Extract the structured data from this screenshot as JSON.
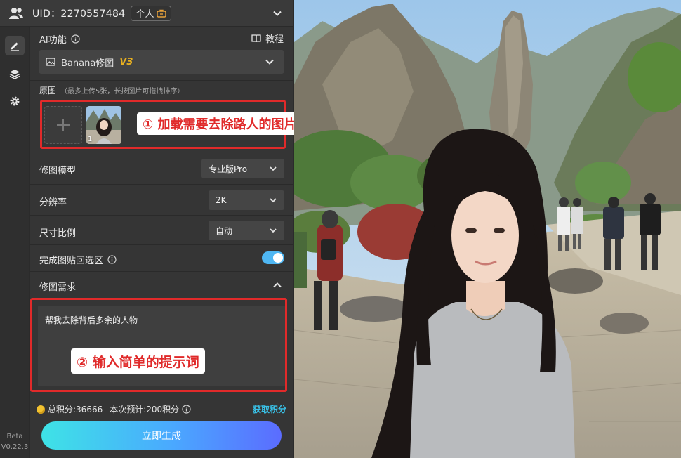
{
  "header": {
    "uid_text": "UID：2270557484",
    "badge_label": "个人"
  },
  "panel": {
    "ai_function": "AI功能",
    "tutorial": "教程",
    "mode_name": "Banana修图",
    "mode_version": "V3",
    "upload_label": "原图",
    "upload_hint": "（最多上传5张，长按图片可拖拽排序）",
    "thumb_index": "1",
    "model_label": "修图模型",
    "model_value": "专业版Pro",
    "resolution_label": "分辨率",
    "resolution_value": "2K",
    "ratio_label": "尺寸比例",
    "ratio_value": "自动",
    "paste_back_label": "完成图贴回选区",
    "paste_back_enabled": true,
    "requirement_label": "修图需求",
    "prompt_text": "帮我去除背后多余的人物",
    "total_points": "总积分:36666",
    "estimate_points": "本次预计:200积分",
    "get_points": "获取积分",
    "generate": "立即生成"
  },
  "callouts": {
    "step1": "① 加载需要去除路人的图片",
    "step2": "② 输入简单的提示词"
  },
  "sidebar": {
    "beta": "Beta",
    "version": "V0.22.3"
  },
  "colors": {
    "accent": "#4aa8ff",
    "highlight": "#e12a2a",
    "version_tag": "#e8b020",
    "toggle_on": "#4fb7f3"
  }
}
